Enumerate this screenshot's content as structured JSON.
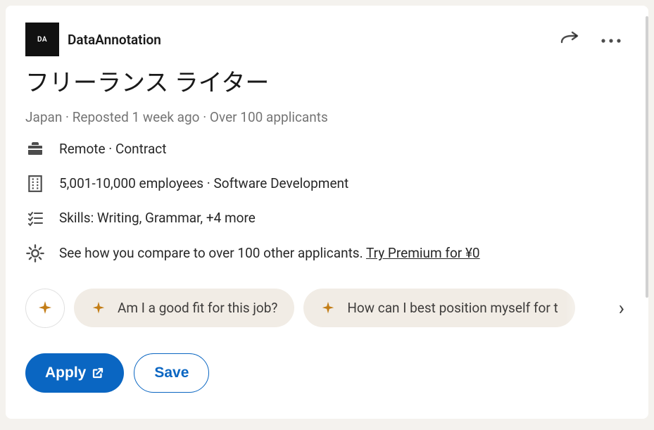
{
  "company": {
    "name": "DataAnnotation",
    "logo_text": "DA"
  },
  "job": {
    "title": "フリーランス ライター",
    "meta": "Japan · Reposted 1 week ago · Over 100 applicants"
  },
  "details": {
    "workplace": "Remote · Contract",
    "company_size": "5,001-10,000 employees · Software Development",
    "skills": "Skills: Writing, Grammar, +4 more",
    "premium_prefix": "See how you compare to over 100 other applicants. ",
    "premium_link": "Try Premium for ¥0"
  },
  "suggestions": {
    "item1": "Am I a good fit for this job?",
    "item2": "How can I best position myself for t"
  },
  "actions": {
    "apply": "Apply",
    "save": "Save"
  }
}
